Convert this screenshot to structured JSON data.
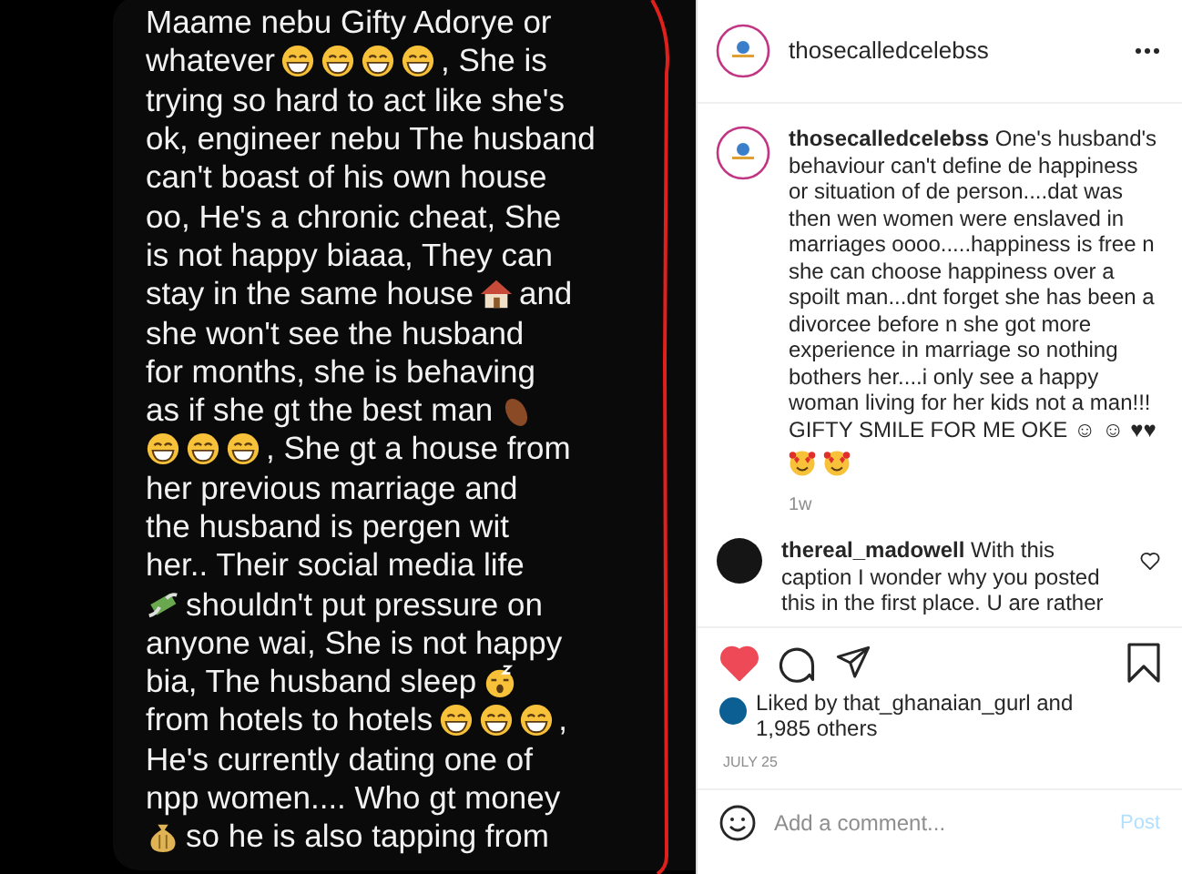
{
  "note": {
    "lines": [
      [
        {
          "kind": "text",
          "text": "Maame nebu Gifty Adorye or"
        }
      ],
      [
        {
          "kind": "text",
          "text": "whatever"
        },
        {
          "kind": "grin"
        },
        {
          "kind": "grin"
        },
        {
          "kind": "grin"
        },
        {
          "kind": "grin"
        },
        {
          "kind": "text",
          "text": ", She is"
        }
      ],
      [
        {
          "kind": "text",
          "text": "trying so hard to act like she's"
        }
      ],
      [
        {
          "kind": "text",
          "text": "ok, engineer nebu The husband"
        }
      ],
      [
        {
          "kind": "text",
          "text": "can't boast of his own house"
        }
      ],
      [
        {
          "kind": "text",
          "text": "oo, He's a chronic cheat, She"
        }
      ],
      [
        {
          "kind": "text",
          "text": "is not happy biaaa, They can"
        }
      ],
      [
        {
          "kind": "text",
          "text": "stay in the same house"
        },
        {
          "kind": "house"
        },
        {
          "kind": "text",
          "text": "and"
        }
      ],
      [
        {
          "kind": "text",
          "text": "she won't see the husband"
        }
      ],
      [
        {
          "kind": "text",
          "text": "for months, she is behaving"
        }
      ],
      [
        {
          "kind": "text",
          "text": "as if she gt the best man"
        },
        {
          "kind": "potato"
        }
      ],
      [
        {
          "kind": "grin"
        },
        {
          "kind": "grin"
        },
        {
          "kind": "grin"
        },
        {
          "kind": "text",
          "text": ", She gt a house from"
        }
      ],
      [
        {
          "kind": "text",
          "text": "her previous marriage and"
        }
      ],
      [
        {
          "kind": "text",
          "text": "the husband is pergen wit"
        }
      ],
      [
        {
          "kind": "text",
          "text": "her.. Their social media life"
        }
      ],
      [
        {
          "kind": "money-wings"
        },
        {
          "kind": "text",
          "text": "shouldn't put pressure on"
        }
      ],
      [
        {
          "kind": "text",
          "text": "anyone wai, She is not happy"
        }
      ],
      [
        {
          "kind": "text",
          "text": "bia, The husband sleep"
        },
        {
          "kind": "sleepy"
        }
      ],
      [
        {
          "kind": "text",
          "text": "from hotels to hotels"
        },
        {
          "kind": "grin"
        },
        {
          "kind": "grin"
        },
        {
          "kind": "grin"
        },
        {
          "kind": "text",
          "text": ","
        }
      ],
      [
        {
          "kind": "text",
          "text": "He's currently dating one of"
        }
      ],
      [
        {
          "kind": "text",
          "text": "npp women.... Who gt money"
        }
      ],
      [
        {
          "kind": "money-bag"
        },
        {
          "kind": "text",
          "text": "so he is also tapping from"
        }
      ]
    ]
  },
  "post": {
    "username": "thosecalledcelebss",
    "caption": {
      "text": "**thosecalledcelebss** One's husband's behaviour can't define de happiness or situation of de person....dat was then wen women were enslaved in marriages oooo.....happiness is free n she can choose happiness over a spoilt man...dnt forget she has been a divorcee before n she got more experience in marriage so nothing bothers her....i only see a happy woman living for her kids not a man!!! GIFTY SMILE FOR ME OKE ☺ ☺ ♥♥",
      "emojis": [
        {
          "kind": "heart-eyes"
        },
        {
          "kind": "heart-eyes"
        }
      ],
      "time": "1w"
    },
    "comments": [
      {
        "text": "**thereal_madowell** With this caption I wonder why you posted this in the first place. U are rather",
        "liked": false
      }
    ],
    "liked": true,
    "saved": false,
    "likes": "Liked by that_ghanaian_gurl and 1,985 others",
    "date": "JULY 25",
    "comment_box": {
      "placeholder": "Add a comment...",
      "post": "Post",
      "disabled": true
    }
  }
}
